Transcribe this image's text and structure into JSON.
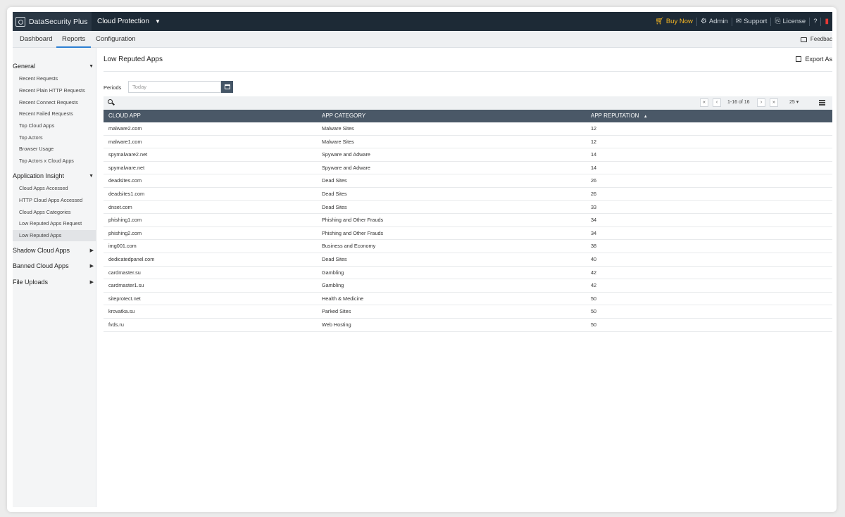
{
  "header": {
    "brand": "DataSecurity Plus",
    "module": "Cloud Protection",
    "links": [
      {
        "label": "Buy Now",
        "icon": "cart-icon"
      },
      {
        "label": "Admin",
        "icon": "admin-icon"
      },
      {
        "label": "Support",
        "icon": "support-icon"
      },
      {
        "label": "License",
        "icon": "license-icon"
      }
    ],
    "help": "?"
  },
  "tabs": [
    {
      "label": "Dashboard"
    },
    {
      "label": "Reports"
    },
    {
      "label": "Configuration"
    }
  ],
  "feedback_label": "Feedbac",
  "sidebar": {
    "general": {
      "title": "General",
      "items": [
        "Recent Requests",
        "Recent Plain HTTP Requests",
        "Recent Connect Requests",
        "Recent Failed Requests",
        "Top Cloud Apps",
        "Top Actors",
        "Browser Usage",
        "Top Actors x Cloud Apps"
      ]
    },
    "insight": {
      "title": "Application Insight",
      "items": [
        "Cloud Apps Accessed",
        "HTTP Cloud Apps Accessed",
        "Cloud Apps Categories",
        "Low Reputed Apps Request",
        "Low Reputed Apps"
      ]
    },
    "shadow": "Shadow Cloud Apps",
    "banned": "Banned Cloud Apps",
    "uploads": "File Uploads"
  },
  "page": {
    "title": "Low Reputed Apps",
    "export_label": "Export As",
    "periods_label": "Periods",
    "periods_placeholder": "Today"
  },
  "pagination": {
    "info": "1-16 of 16",
    "per_page": "25"
  },
  "table": {
    "columns": [
      "CLOUD APP",
      "APP CATEGORY",
      "APP REPUTATION"
    ],
    "rows": [
      [
        "malware2.com",
        "Malware Sites",
        "12"
      ],
      [
        "malware1.com",
        "Malware Sites",
        "12"
      ],
      [
        "spymalware2.net",
        "Spyware and Adware",
        "14"
      ],
      [
        "spymalware.net",
        "Spyware and Adware",
        "14"
      ],
      [
        "deadsites.com",
        "Dead Sites",
        "26"
      ],
      [
        "deadsites1.com",
        "Dead Sites",
        "26"
      ],
      [
        "dnset.com",
        "Dead Sites",
        "33"
      ],
      [
        "phishing1.com",
        "Phishing and Other Frauds",
        "34"
      ],
      [
        "phishing2.com",
        "Phishing and Other Frauds",
        "34"
      ],
      [
        "img001.com",
        "Business and Economy",
        "38"
      ],
      [
        "dedicatedpanel.com",
        "Dead Sites",
        "40"
      ],
      [
        "cardmaster.su",
        "Gambling",
        "42"
      ],
      [
        "cardmaster1.su",
        "Gambling",
        "42"
      ],
      [
        "siteprotect.net",
        "Health & Medicine",
        "50"
      ],
      [
        "krovatka.su",
        "Parked Sites",
        "50"
      ],
      [
        "fvds.ru",
        "Web Hosting",
        "50"
      ]
    ]
  },
  "colors": {
    "topbar": "#1d2a36",
    "table_header": "#4a5867",
    "accent": "#2b7fd3",
    "buy_now": "#f5b623"
  }
}
